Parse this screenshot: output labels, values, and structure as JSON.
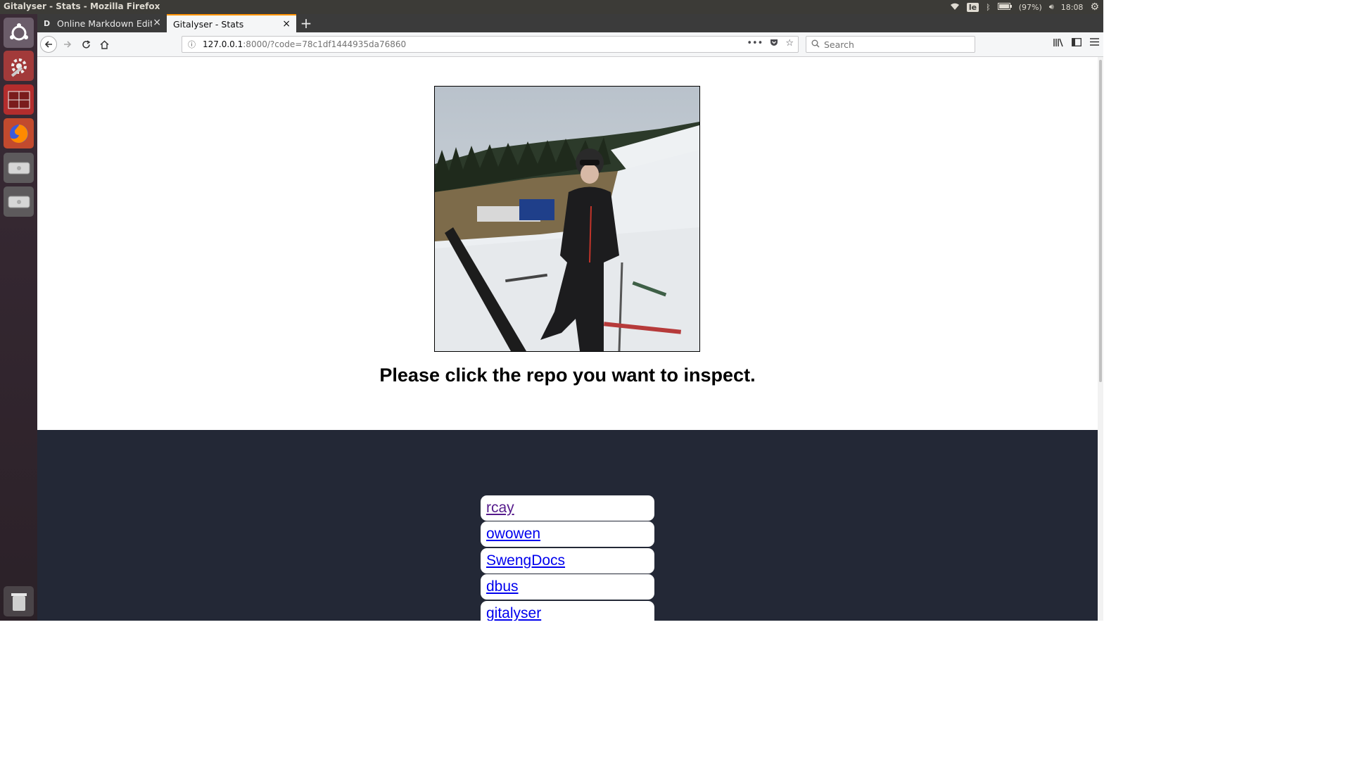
{
  "system": {
    "window_title": "Gitalyser - Stats - Mozilla Firefox",
    "keyboard_layout": "le",
    "battery": "(97%)",
    "clock": "18:08"
  },
  "launcher": {
    "items": [
      "ubuntu-logo-icon",
      "system-settings-icon",
      "workspace-switcher-icon",
      "firefox-icon",
      "drive-icon",
      "drive-icon",
      "trash-icon"
    ]
  },
  "tabs": [
    {
      "favicon": "D",
      "label": "Online Markdown Editor",
      "active": false
    },
    {
      "favicon": "",
      "label": "Gitalyser - Stats",
      "active": true
    }
  ],
  "nav": {
    "url_host": "127.0.0.1",
    "url_path": ":8000/?code=78c1df1444935da76860",
    "search_placeholder": "Search"
  },
  "page": {
    "photo_alt": "Skier standing on a snowy slope",
    "heading": "Please click the repo you want to inspect.",
    "repos": [
      {
        "name": "rcay",
        "visited": true
      },
      {
        "name": "owowen",
        "visited": false
      },
      {
        "name": "SwengDocs",
        "visited": false
      },
      {
        "name": "dbus",
        "visited": false
      },
      {
        "name": "gitalyser",
        "visited": false
      }
    ]
  },
  "colors": {
    "dark_section": "#232836",
    "link": "#0000ee",
    "visited_link": "#551a8b",
    "active_tab_accent": "#ff9400"
  }
}
